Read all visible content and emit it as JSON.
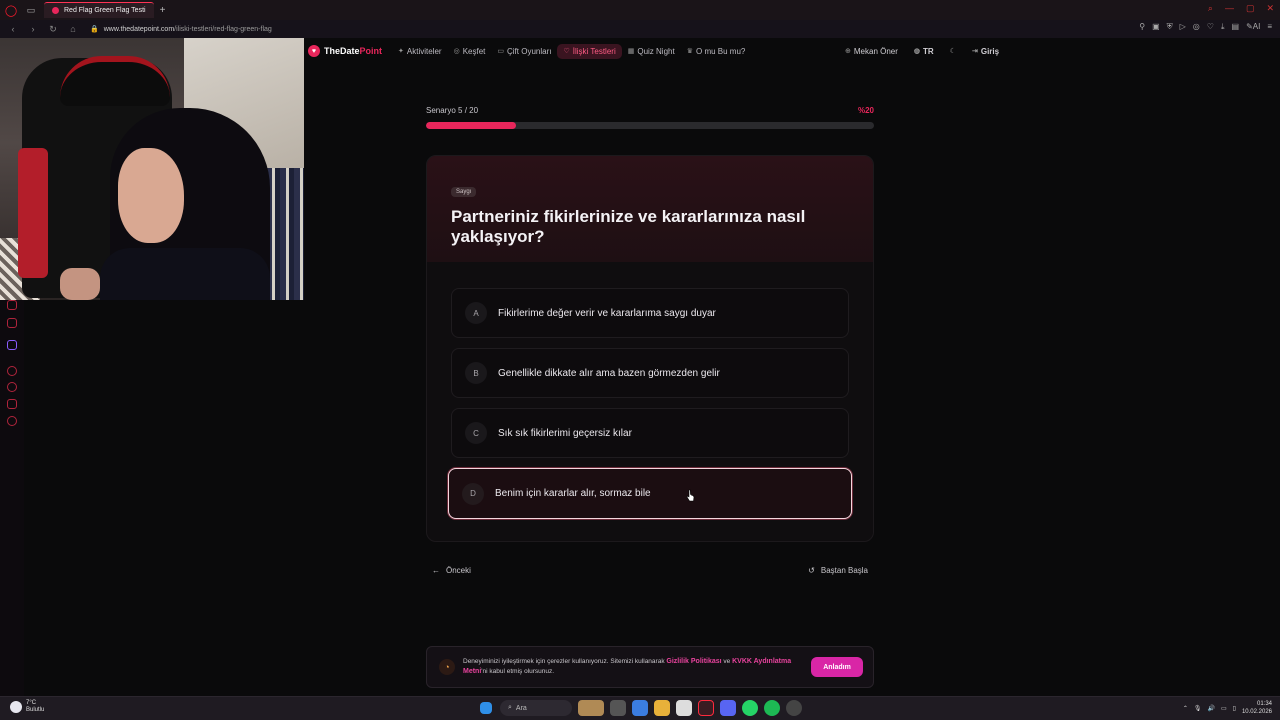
{
  "browser": {
    "tab_title": "Red Flag Green Flag Testi",
    "url_host": "www.thedatepoint.com",
    "url_path": "/iliski-testleri/red-flag-green-flag",
    "new_tab": "+"
  },
  "site": {
    "logo_the_date": "TheDate",
    "logo_point": "Point",
    "nav": [
      {
        "label": "Aktiviteler",
        "icon": "sparkle-icon"
      },
      {
        "label": "Keşfet",
        "icon": "compass-icon"
      },
      {
        "label": "Çift Oyunları",
        "icon": "chat-icon"
      },
      {
        "label": "İlişki Testleri",
        "icon": "heart-icon"
      },
      {
        "label": "Quiz Night",
        "icon": "calendar-icon"
      },
      {
        "label": "O mu Bu mu?",
        "icon": "trophy-icon"
      }
    ],
    "right": {
      "suggest": "Mekan Öner",
      "lang": "TR",
      "login": "Giriş"
    }
  },
  "quiz": {
    "progress_label": "Senaryo 5 / 20",
    "progress_percent_label": "%20",
    "progress_fraction": 0.2,
    "tag": "Saygı",
    "question": "Partneriniz fikirlerinize ve kararlarınıza nasıl yaklaşıyor?",
    "options": [
      {
        "letter": "A",
        "text": "Fikirlerime değer verir ve kararlarıma saygı duyar"
      },
      {
        "letter": "B",
        "text": "Genellikle dikkate alır ama bazen görmezden gelir"
      },
      {
        "letter": "C",
        "text": "Sık sık fikirlerimi geçersiz kılar"
      },
      {
        "letter": "D",
        "text": "Benim için kararlar alır, sormaz bile"
      }
    ],
    "selected": "D",
    "prev": "Önceki",
    "restart": "Baştan Başla"
  },
  "cookie": {
    "text_pre": "Deneyiminizi iyileştirmek için çerezler kullanıyoruz. Sitemizi kullanarak ",
    "privacy": "Gizlilik Politikası",
    "and": " ve ",
    "kvkk": "KVKK Aydınlatma Metni",
    "text_post": "'ni kabul etmiş olursunuz.",
    "button": "Anladım"
  },
  "taskbar": {
    "temp": "7°C",
    "weather": "Bulutlu",
    "search": "Ara",
    "time": "01:34",
    "date": "10.02.2026"
  },
  "colors": {
    "accent": "#e8265b",
    "cookie_button": "#d926a6"
  }
}
